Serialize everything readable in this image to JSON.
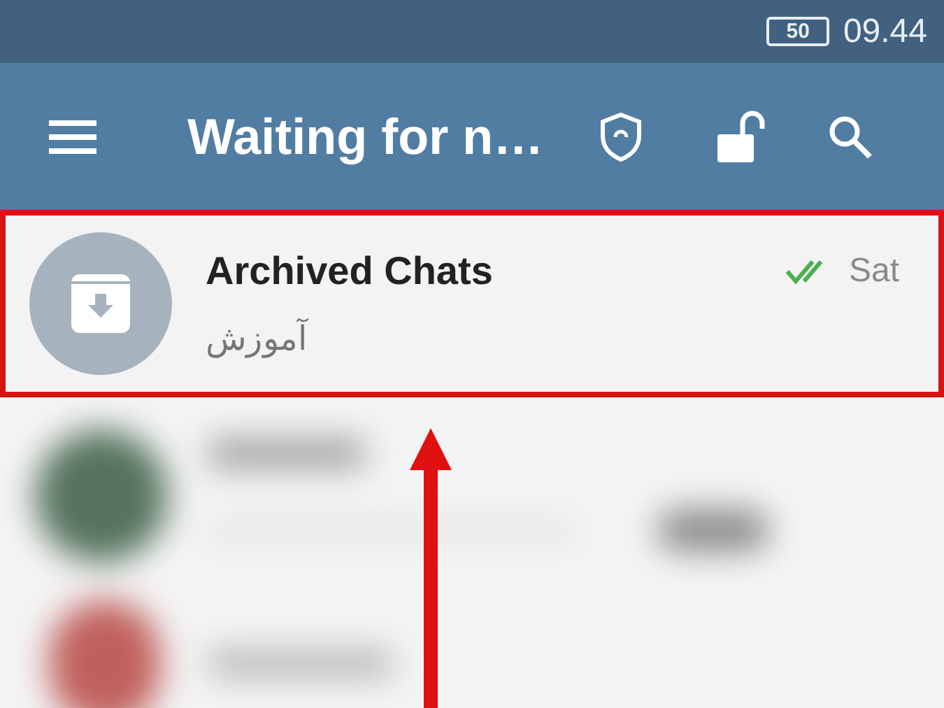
{
  "status_bar": {
    "battery": "50",
    "time": "09.44"
  },
  "toolbar": {
    "title": "Waiting for n…"
  },
  "archived_chats": {
    "title": "Archived Chats",
    "preview": "آموزش",
    "time": "Sat",
    "read": true,
    "highlighted": true
  }
}
